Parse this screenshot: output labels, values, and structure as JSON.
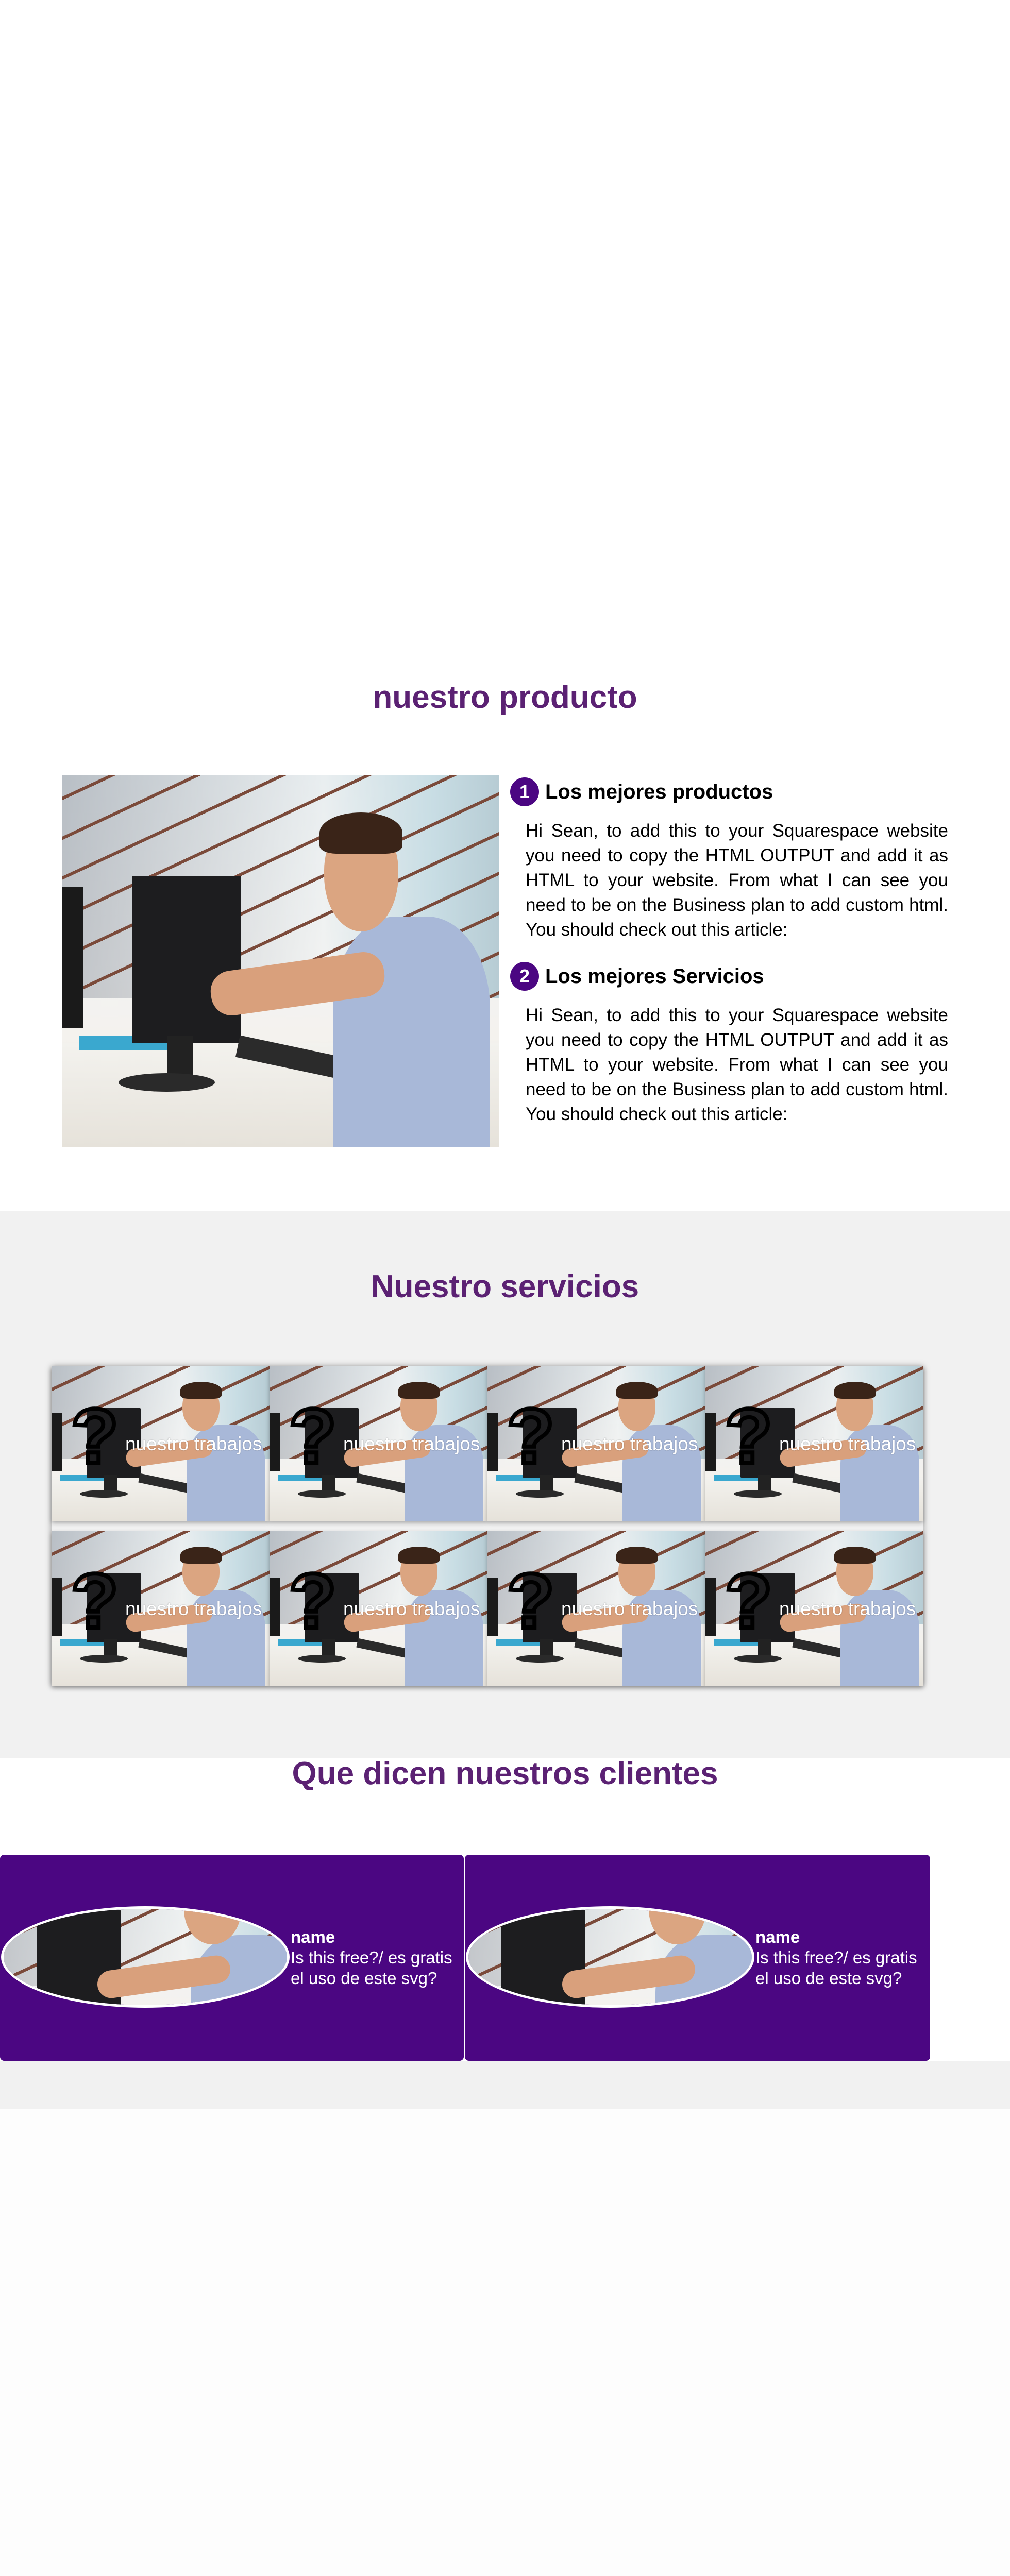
{
  "product": {
    "title": "nuestro producto",
    "features": [
      {
        "number": "1",
        "title": "Los mejores productos",
        "text": "Hi Sean, to add this to your Squarespace website you need to copy the HTML OUTPUT and add it as HTML to your website. From what I can see you need to be on the Business plan to add custom html. You should check out this article:"
      },
      {
        "number": "2",
        "title": "Los mejores Servicios",
        "text": "Hi Sean, to add this to your Squarespace website you need to copy the HTML OUTPUT and add it as HTML to your website. From what I can see you need to be on the Business plan to add custom html. You should check out this article:"
      }
    ]
  },
  "services": {
    "title": "Nuestro servicios",
    "tile_caption": "nuestro trabajos",
    "tile_icon": "question-mark-icon",
    "tile_count": 8
  },
  "clients": {
    "title": "Que dicen nuestros clientes",
    "cards": [
      {
        "name": "name",
        "quote_line1": "Is this free?/ es gratis",
        "quote_line2": "el uso de este svg?"
      },
      {
        "name": "name",
        "quote_line1": "Is this free?/ es gratis",
        "quote_line2": "el uso de este svg?"
      }
    ]
  },
  "colors": {
    "heading": "#5b2173",
    "accent": "#4b0682",
    "section_gray": "#f1f1f1"
  }
}
